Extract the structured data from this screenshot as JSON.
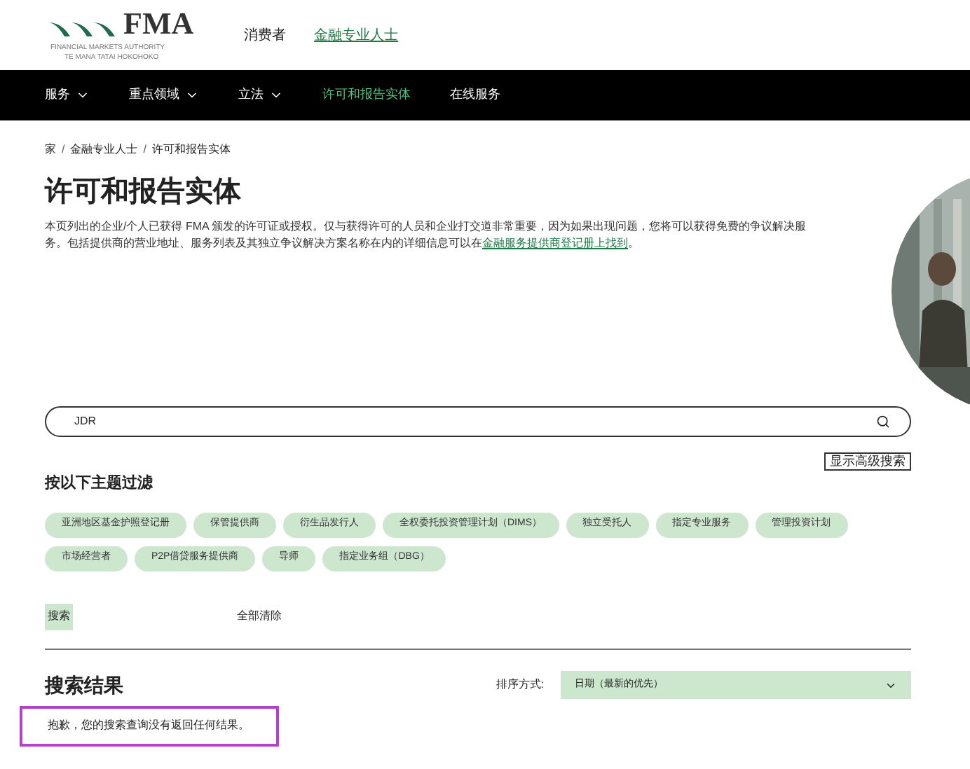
{
  "logo": {
    "mark": "FMA",
    "subtitle": "FINANCIAL MARKETS AUTHORITY",
    "subtitle_2": "TE MANA TATAI HOKOHOKO"
  },
  "audience_links": [
    {
      "label": "消费者",
      "selected": false
    },
    {
      "label": "金融专业人士",
      "selected": true
    }
  ],
  "nav": [
    {
      "label": "服务",
      "has_menu": true,
      "selected": false
    },
    {
      "label": "重点领域",
      "has_menu": true,
      "selected": false
    },
    {
      "label": "立法",
      "has_menu": true,
      "selected": false
    },
    {
      "label": "许可和报告实体",
      "has_menu": false,
      "selected": true
    },
    {
      "label": "在线服务",
      "has_menu": false,
      "selected": false
    }
  ],
  "breadcrumb": [
    {
      "label": "家",
      "separator": "/"
    },
    {
      "label": "金融专业人士",
      "separator": "/"
    },
    {
      "label": "许可和报告实体"
    }
  ],
  "title": "许可和报告实体",
  "intro": {
    "text": "本页列出的企业/个人已获得 FMA 颁发的许可证或授权。仅与获得许可的人员和企业打交道非常重要，因为如果出现问题，您将可以获得免费的争议解决服务。包括提供商的营业地址、服务列表及其独立争议解决方案名称在内的详细信息可以在",
    "link": "金融服务提供商登记册上找到",
    "end": "。"
  },
  "search": {
    "value": "JDR"
  },
  "advanced_search": "显示高级搜索",
  "filter_heading": "按以下主题过滤",
  "topics": [
    {
      "label": "亚洲地区基金护照登记册",
      "selected": false
    },
    {
      "label": "保管提供商",
      "selected": false
    },
    {
      "label": "衍生品发行人",
      "selected": false
    },
    {
      "label": "全权委托投资管理计划（DIMS）",
      "selected": false
    },
    {
      "label": "独立受托人",
      "selected": false
    },
    {
      "label": "指定专业服务",
      "selected": false
    },
    {
      "label": "管理投资计划",
      "selected": false
    },
    {
      "label": "市场经营者",
      "selected": false
    },
    {
      "label": "P2P借贷服务提供商",
      "selected": false
    },
    {
      "label": "导师",
      "selected": false
    },
    {
      "label": "指定业务组（DBG）",
      "selected": false
    }
  ],
  "search_button": "搜索",
  "clear_all": "全部清除",
  "results_heading": "搜索结果",
  "sort": {
    "label": "排序方式:",
    "value": "日期（最新的优先）"
  },
  "no_results": {
    "text": "抱歉，您的搜索查询没有返回任何结果。",
    "highlighted": true
  }
}
